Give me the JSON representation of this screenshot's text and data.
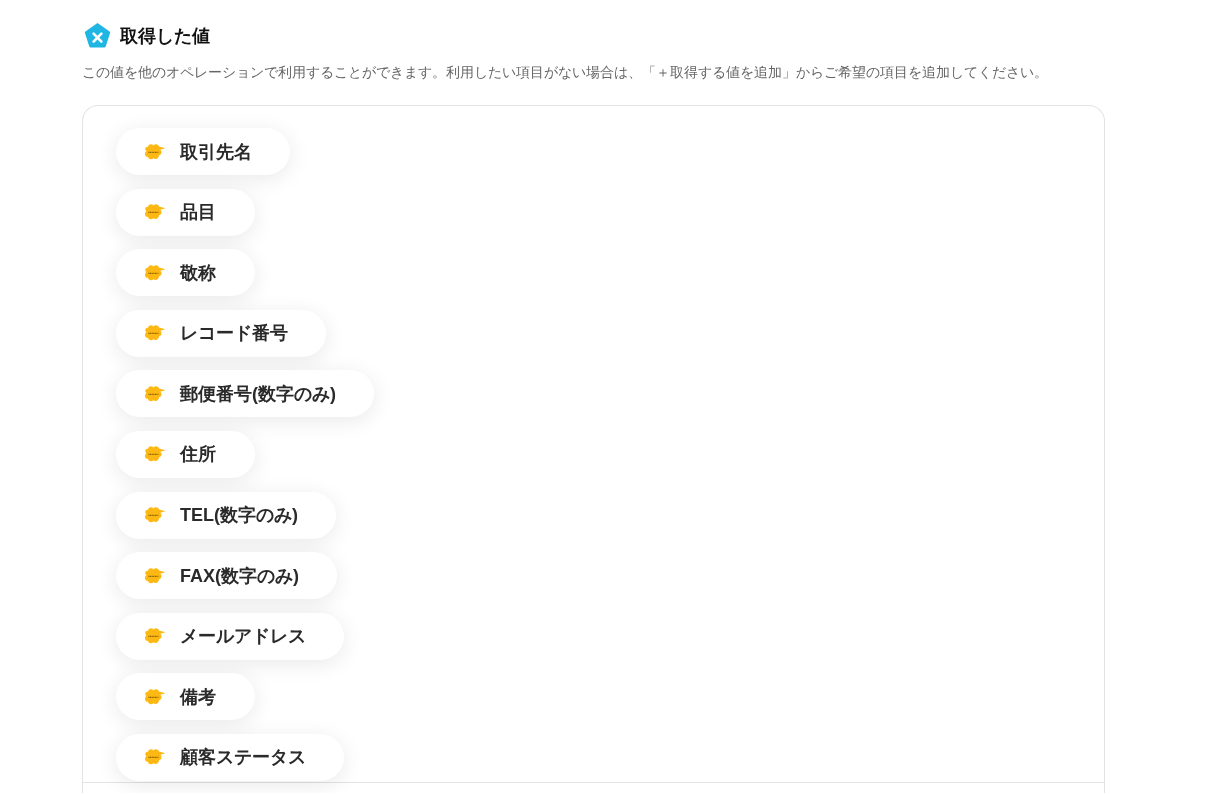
{
  "section": {
    "title": "取得した値",
    "description": "この値を他のオペレーションで利用することができます。利用したい項目がない場合は、「＋取得する値を追加」からご希望の項目を追加してください。"
  },
  "values": [
    {
      "label": "取引先名"
    },
    {
      "label": "品目"
    },
    {
      "label": "敬称"
    },
    {
      "label": "レコード番号"
    },
    {
      "label": "郵便番号(数字のみ)"
    },
    {
      "label": "住所"
    },
    {
      "label": "TEL(数字のみ)"
    },
    {
      "label": "FAX(数字のみ)"
    },
    {
      "label": "メールアドレス"
    },
    {
      "label": "備考"
    },
    {
      "label": "顧客ステータス"
    }
  ]
}
